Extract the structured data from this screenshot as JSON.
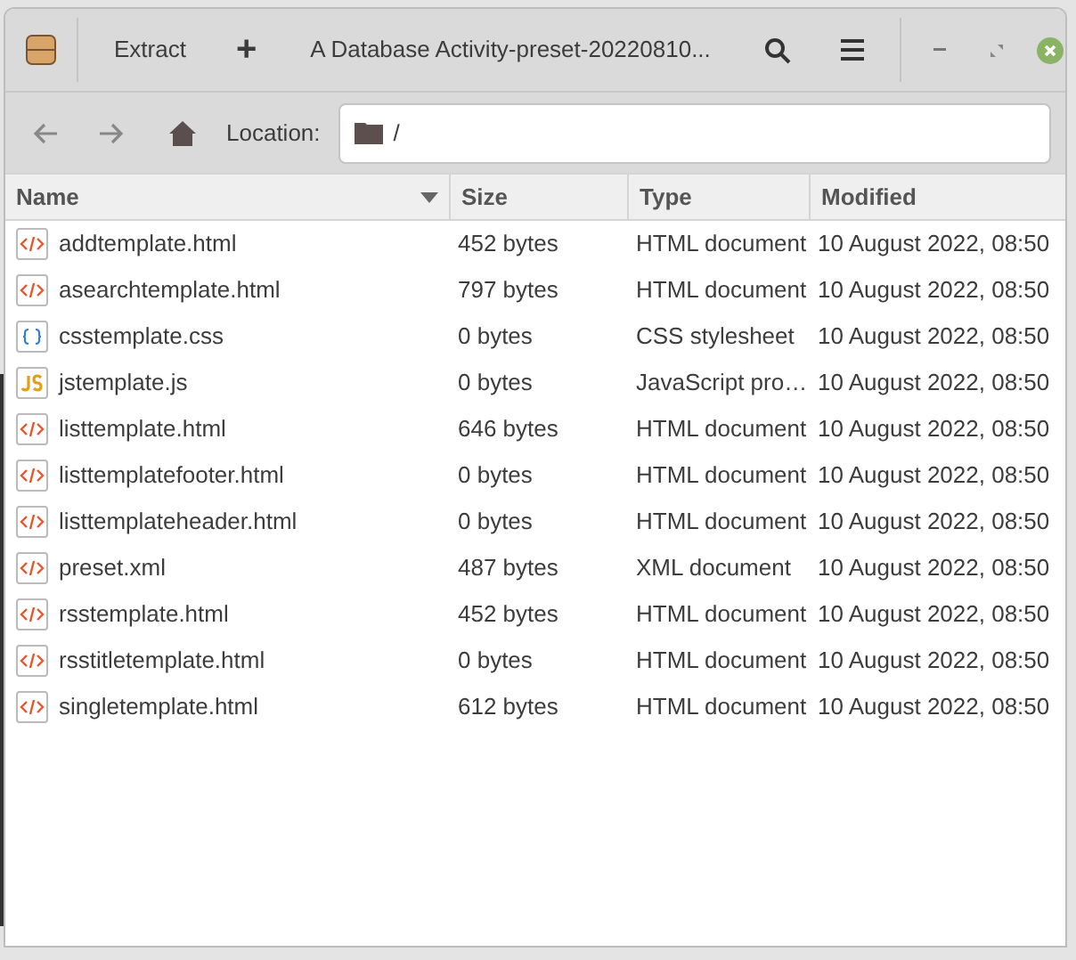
{
  "window": {
    "title": "A Database Activity-preset-20220810...",
    "extract_button": "Extract",
    "add_button": "+"
  },
  "location_bar": {
    "label": "Location:",
    "path": "/"
  },
  "table": {
    "columns": [
      {
        "label": "Name",
        "sorted": true
      },
      {
        "label": "Size",
        "sorted": false
      },
      {
        "label": "Type",
        "sorted": false
      },
      {
        "label": "Modified",
        "sorted": false
      }
    ],
    "rows": [
      {
        "kind": "html",
        "name": "addtemplate.html",
        "size": "452 bytes",
        "type": "HTML document",
        "modified": "10 August 2022, 08:50"
      },
      {
        "kind": "html",
        "name": "asearchtemplate.html",
        "size": "797 bytes",
        "type": "HTML document",
        "modified": "10 August 2022, 08:50"
      },
      {
        "kind": "css",
        "name": "csstemplate.css",
        "size": "0 bytes",
        "type": "CSS stylesheet",
        "modified": "10 August 2022, 08:50"
      },
      {
        "kind": "js",
        "name": "jstemplate.js",
        "size": "0 bytes",
        "type": "JavaScript pro…",
        "modified": "10 August 2022, 08:50"
      },
      {
        "kind": "html",
        "name": "listtemplate.html",
        "size": "646 bytes",
        "type": "HTML document",
        "modified": "10 August 2022, 08:50"
      },
      {
        "kind": "html",
        "name": "listtemplatefooter.html",
        "size": "0 bytes",
        "type": "HTML document",
        "modified": "10 August 2022, 08:50"
      },
      {
        "kind": "html",
        "name": "listtemplateheader.html",
        "size": "0 bytes",
        "type": "HTML document",
        "modified": "10 August 2022, 08:50"
      },
      {
        "kind": "html",
        "name": "preset.xml",
        "size": "487 bytes",
        "type": "XML document",
        "modified": "10 August 2022, 08:50"
      },
      {
        "kind": "html",
        "name": "rsstemplate.html",
        "size": "452 bytes",
        "type": "HTML document",
        "modified": "10 August 2022, 08:50"
      },
      {
        "kind": "html",
        "name": "rsstitletemplate.html",
        "size": "0 bytes",
        "type": "HTML document",
        "modified": "10 August 2022, 08:50"
      },
      {
        "kind": "html",
        "name": "singletemplate.html",
        "size": "612 bytes",
        "type": "HTML document",
        "modified": "10 August 2022, 08:50"
      }
    ]
  }
}
